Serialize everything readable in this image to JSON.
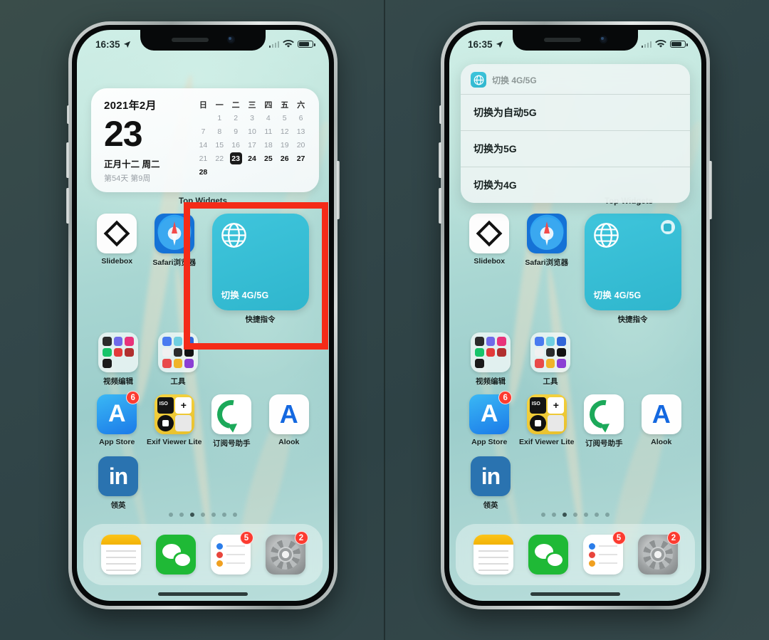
{
  "status_bar": {
    "time": "16:35",
    "location_icon": "location-arrow-icon",
    "signal_icon": "cellular-signal-icon",
    "wifi_icon": "wifi-icon",
    "battery_icon": "battery-icon"
  },
  "calendar_widget": {
    "month": "2021年2月",
    "day": "23",
    "lunar": "正月十二 周二",
    "sub": "第54天 第9周",
    "weekday_headers": [
      "日",
      "一",
      "二",
      "三",
      "四",
      "五",
      "六"
    ],
    "cells": [
      "",
      "1",
      "2",
      "3",
      "4",
      "5",
      "6",
      "7",
      "8",
      "9",
      "10",
      "11",
      "12",
      "13",
      "14",
      "15",
      "16",
      "17",
      "18",
      "19",
      "20",
      "21",
      "22",
      "23",
      "24",
      "25",
      "26",
      "27",
      "28",
      "",
      "",
      "",
      "",
      "",
      ""
    ],
    "today": "23",
    "bold_from": "24"
  },
  "widget_section_label": "Top Widgets",
  "shortcut_widget": {
    "title": "切换 4G/5G",
    "app_label": "快捷指令",
    "color": "#2fb6cd",
    "globe_icon": "globe-icon",
    "badge_icon": "shortcuts-badge-icon"
  },
  "apps": {
    "row1": [
      {
        "label": "Slidebox",
        "icon": "slidebox-icon"
      },
      {
        "label": "Safari浏览器",
        "icon": "safari-icon"
      }
    ],
    "row2": [
      {
        "label": "视频编辑",
        "icon": "folder-icon"
      },
      {
        "label": "工具",
        "icon": "folder-icon"
      }
    ],
    "row3": [
      {
        "label": "App Store",
        "icon": "app-store-icon",
        "badge": "6"
      },
      {
        "label": "Exif Viewer Lite",
        "icon": "exif-viewer-icon",
        "badge": ""
      },
      {
        "label": "订阅号助手",
        "icon": "dingyuehao-icon",
        "badge": ""
      },
      {
        "label": "Alook",
        "icon": "alook-icon",
        "badge": ""
      }
    ],
    "row4": [
      {
        "label": "领英",
        "icon": "linkedin-icon"
      }
    ]
  },
  "dock": [
    {
      "label": "备忘录",
      "icon": "notes-icon",
      "badge": ""
    },
    {
      "label": "微信",
      "icon": "wechat-icon",
      "badge": ""
    },
    {
      "label": "提醒事项",
      "icon": "reminders-icon",
      "badge": "5"
    },
    {
      "label": "设置",
      "icon": "settings-icon",
      "badge": "2"
    }
  ],
  "page_dots": {
    "count": 7,
    "active_index": 2
  },
  "popup_menu": {
    "header": "切换 4G/5G",
    "header_icon": "globe-icon",
    "items": [
      "切换为自动5G",
      "切换为5G",
      "切换为4G"
    ]
  },
  "highlight": {
    "color": "#f42b18",
    "name": "red-highlight-box"
  },
  "folder_tiles": {
    "video": [
      "#2b2b2b",
      "#6f6ae8",
      "#e8337a",
      "#17c46a",
      "#e33a3a",
      "#b02f2f",
      "#1a1a1a",
      "",
      ""
    ],
    "tools": [
      "#4a7bf0",
      "#6fcfe0",
      "#3166d8",
      "#f0f0f0",
      "#2b2b2b",
      "#111111",
      "#e84a4a",
      "#f0b429",
      "#8b3fd4"
    ]
  }
}
